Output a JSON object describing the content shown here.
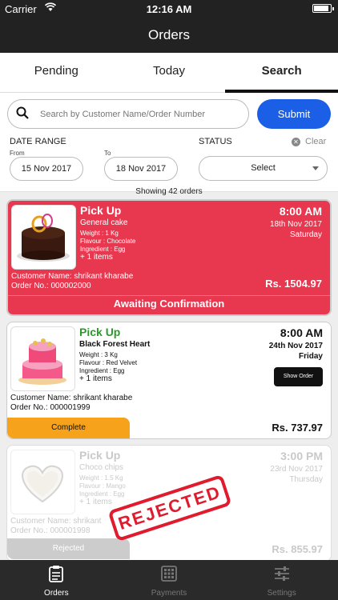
{
  "status_bar": {
    "carrier": "Carrier",
    "time": "12:16 AM",
    "battery_level": 0.8
  },
  "nav": {
    "title": "Orders"
  },
  "tabs": [
    {
      "label": "Pending",
      "active": false
    },
    {
      "label": "Today",
      "active": false
    },
    {
      "label": "Search",
      "active": true
    }
  ],
  "search": {
    "placeholder": "Search by Customer Name/Order Number",
    "value": "",
    "submit_label": "Submit",
    "date_range_label": "DATE RANGE",
    "from_label": "From",
    "to_label": "To",
    "from_value": "15 Nov 2017",
    "to_value": "18 Nov 2017",
    "status_label": "STATUS",
    "clear_label": "Clear",
    "status_value": "Select"
  },
  "showing": "Showing 42 orders",
  "orders": [
    {
      "type": "Pick Up",
      "name": "General cake",
      "weight": "Weight : 1 Kg",
      "flavour": "Flavour : Chocolate",
      "ingredient": "Ingredient : Egg",
      "more": "+ 1 items",
      "time": "8:00 AM",
      "date": "18th Nov 2017",
      "day": "Saturday",
      "customer": "Customer Name: shrikant kharabe",
      "order_no": "Order No.: 000002000",
      "price": "Rs. 1504.97",
      "status": "Awaiting Confirmation",
      "color": "#e83850"
    },
    {
      "type": "Pick Up",
      "name": "Black Forest Heart",
      "weight": "Weight : 3 Kg",
      "flavour": "Flavour : Red Velvet",
      "ingredient": "Ingredient : Egg",
      "more": "+ 1 items",
      "time": "8:00 AM",
      "date": "24th Nov 2017",
      "day": "Friday",
      "customer": "Customer Name: shrikant kharabe",
      "order_no": "Order No.: 000001999",
      "price": "Rs. 737.97",
      "show_order_label": "Show Order",
      "status": "Complete",
      "color": "#f6a21a"
    },
    {
      "type": "Pick Up",
      "name": "Choco chips",
      "weight": "Weight : 1.5 Kg",
      "flavour": "Flavour : Mango",
      "ingredient": "Ingredient : Egg",
      "more": "+ 1 items",
      "time": "3:00 PM",
      "date": "23rd Nov 2017",
      "day": "Thursday",
      "customer": "Customer Name: shrikant",
      "order_no": "Order No.: 000001998",
      "price": "Rs. 855.97",
      "stamp": "REJECTED",
      "status": "Rejected",
      "color": "#cccccc"
    }
  ],
  "bottom_tabs": [
    {
      "label": "Orders",
      "icon": "clipboard-icon",
      "active": true
    },
    {
      "label": "Payments",
      "icon": "calculator-icon",
      "active": false
    },
    {
      "label": "Settings",
      "icon": "sliders-icon",
      "active": false
    }
  ]
}
